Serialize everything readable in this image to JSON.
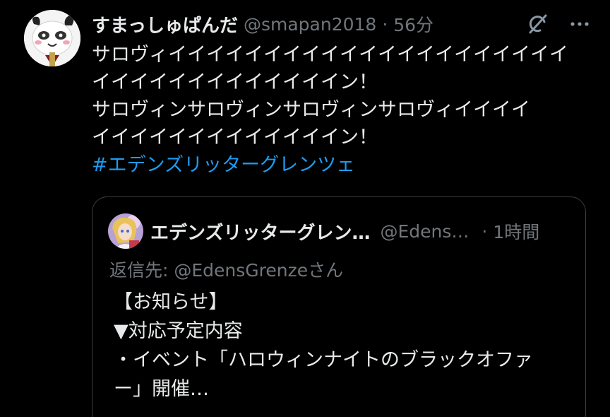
{
  "tweet": {
    "display_name": "すまっしゅぱんだ",
    "handle": "@smapan2018",
    "separator": "·",
    "time": "56分",
    "avatar_icon": "panda-avatar-icon",
    "header_icons": [
      "grok-icon",
      "more-icon"
    ],
    "text_lines": [
      "サロヴィイイイイイイイイイイイイイイイイイイイイイ",
      "イイイイイイイイイイイイイン！",
      "サロヴィンサロヴィンサロヴィンサロヴィイイイイ",
      "イイイイイイイイイイイイイン！"
    ],
    "hashtag": "#エデンズリッターグレンツェ",
    "hashtag_color": "#1d9bf0"
  },
  "quoted_tweet": {
    "display_name": "エデンズリッターグレン…",
    "handle": "@Edens…",
    "separator": "·",
    "time": "1時間",
    "avatar_icon": "anime-character-avatar-icon",
    "reply_prefix": "返信先: ",
    "reply_mention": "@EdensGrenze",
    "reply_suffix": "さん",
    "text_lines": [
      "【お知らせ】",
      "▼対応予定内容",
      "・イベント「ハロウィンナイトのブラックオファ",
      "ー」開催…"
    ]
  }
}
